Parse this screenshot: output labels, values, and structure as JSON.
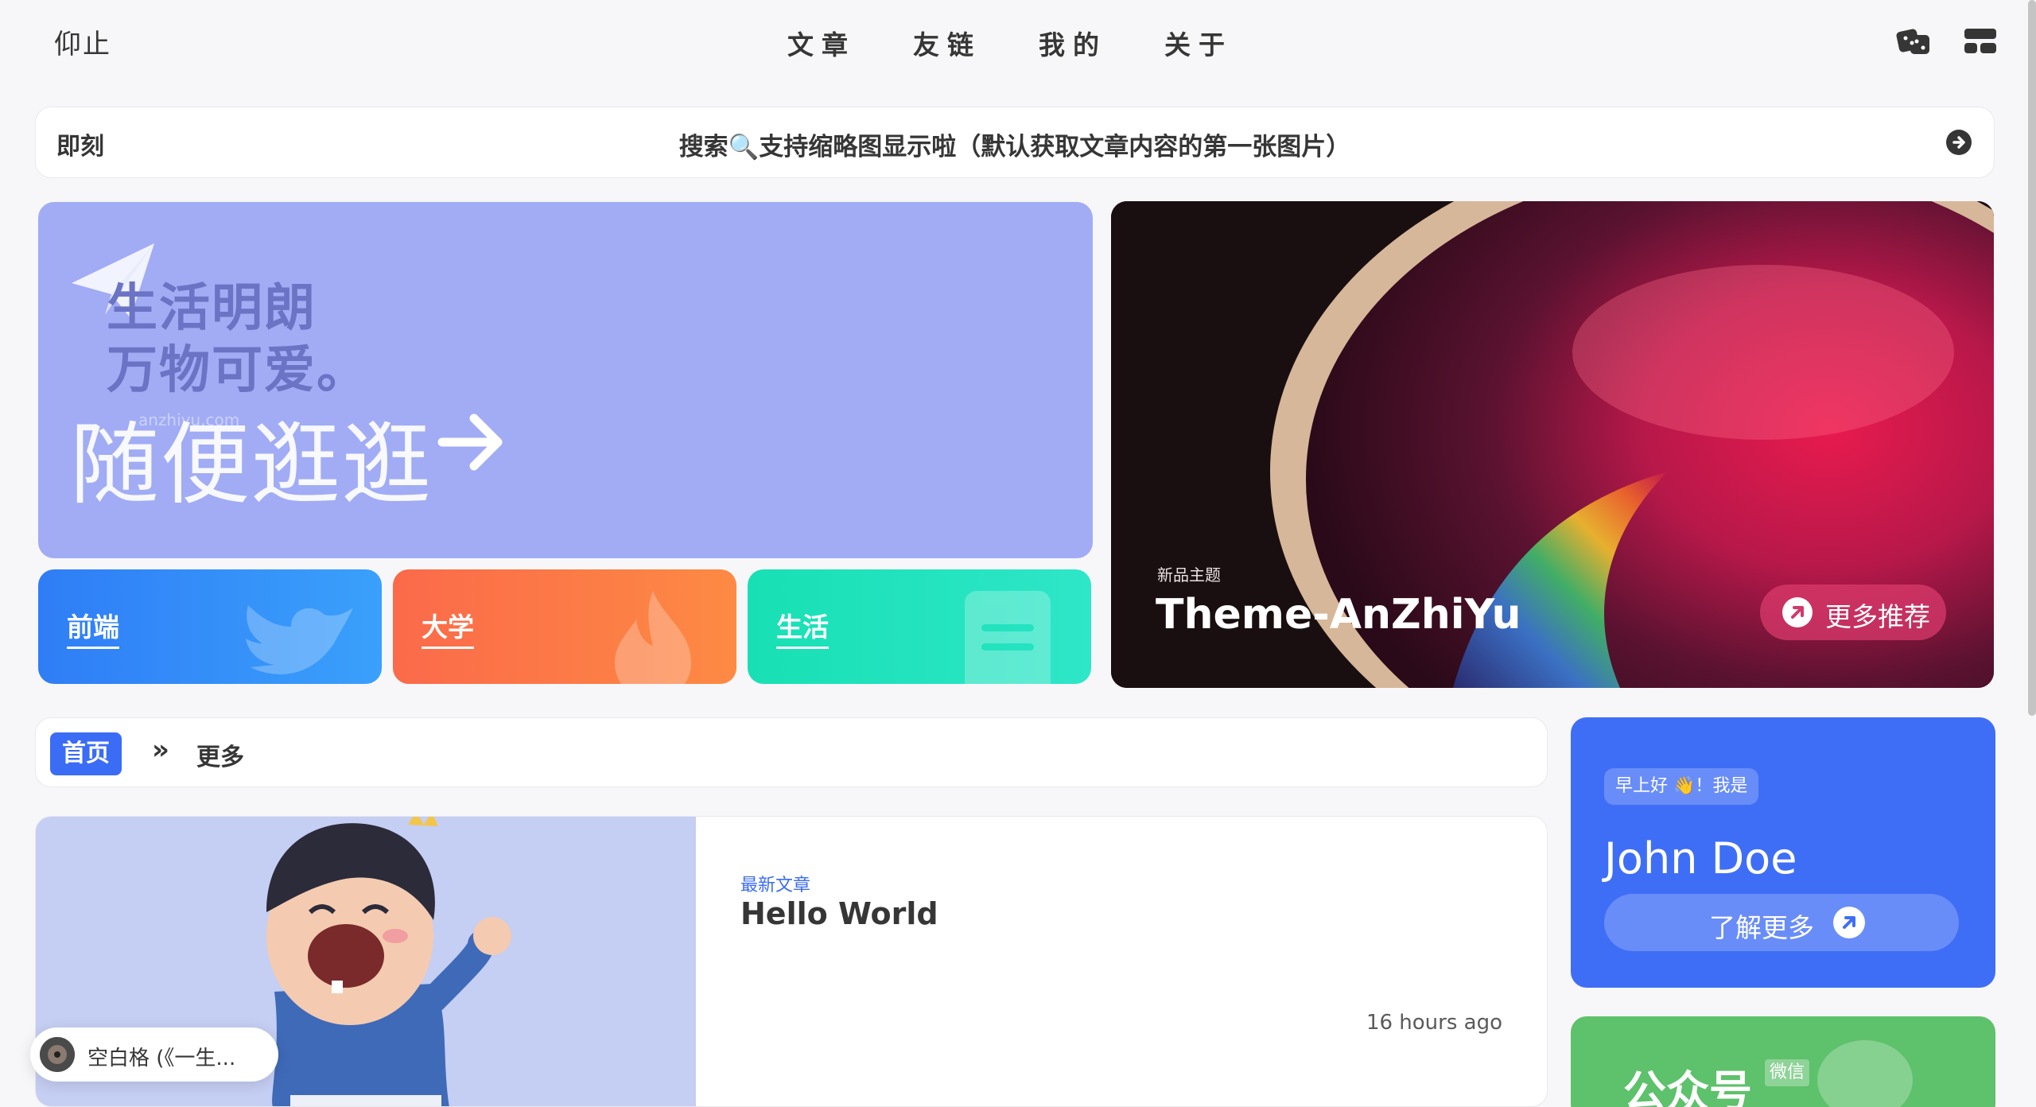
{
  "header": {
    "brand": "仰止",
    "nav": [
      "文章",
      "友链",
      "我的",
      "关于"
    ],
    "icons": [
      "dice-icon",
      "menu-grid-icon"
    ]
  },
  "bulletin": {
    "label": "即刻",
    "text": "搜索🔍支持缩略图显示啦（默认获取文章内容的第一张图片）",
    "icon": "arrow-circle-right-icon"
  },
  "banner": {
    "line1": "生活明朗",
    "line2": "万物可爱。",
    "cta": "随便逛逛",
    "watermark": "anzhiyu.com",
    "icon": "paper-plane-icon",
    "color": "#a1acf5"
  },
  "categories": [
    {
      "label": "前端",
      "color": "#2f7df6"
    },
    {
      "label": "大学",
      "color": "#fb6a4a"
    },
    {
      "label": "生活",
      "color": "#18e0b4"
    }
  ],
  "feature": {
    "tag": "新品主题",
    "title": "Theme-AnZhiYu",
    "button": "更多推荐"
  },
  "breadcrumb": {
    "home": "首页",
    "separator": "»",
    "current": "更多"
  },
  "post": {
    "tag": "最新文章",
    "title": "Hello World",
    "time": "16 hours ago"
  },
  "music": {
    "text": "空白格 (《一生..."
  },
  "author": {
    "greeting": "早上好 👋！我是",
    "name": "John Doe",
    "button": "了解更多"
  },
  "wechat": {
    "title": "公众号",
    "badge": "微信"
  }
}
